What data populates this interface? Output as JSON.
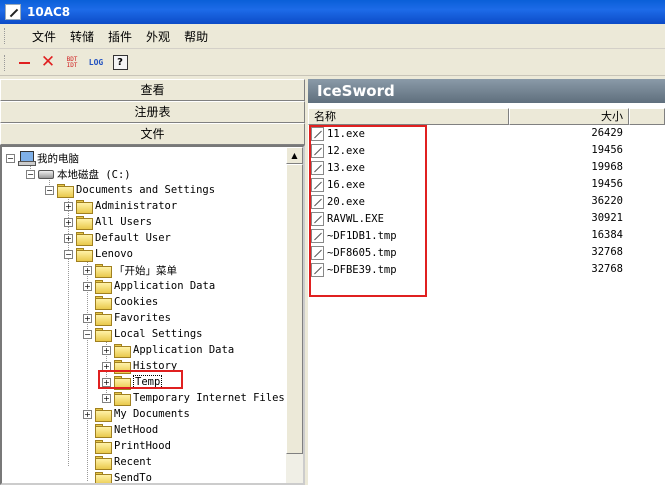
{
  "window": {
    "title": "10AC8"
  },
  "menu": {
    "items": [
      "文件",
      "转储",
      "插件",
      "外观",
      "帮助"
    ]
  },
  "toolbar": {
    "bdt_top": "BDT",
    "bdt_bottom": "IDT",
    "log": "LOG",
    "help": "?"
  },
  "nav": {
    "buttons": [
      "查看",
      "注册表",
      "文件"
    ]
  },
  "tree": {
    "nodes": [
      "我的电脑",
      "本地磁盘 (C:)",
      "Documents and Settings",
      "Administrator",
      "All Users",
      "Default User",
      "Lenovo",
      "「开始」菜单",
      "Application Data",
      "Cookies",
      "Favorites",
      "Local Settings",
      "Application Data",
      "History",
      "Temp",
      "Temporary Internet Files",
      "My Documents",
      "NetHood",
      "PrintHood",
      "Recent",
      "SendTo"
    ]
  },
  "files": {
    "header": "IceSword",
    "col_name": "名称",
    "col_size": "大小",
    "rows": [
      {
        "name": "11.exe",
        "size": "26429"
      },
      {
        "name": "12.exe",
        "size": "19456"
      },
      {
        "name": "13.exe",
        "size": "19968"
      },
      {
        "name": "16.exe",
        "size": "19456"
      },
      {
        "name": "20.exe",
        "size": "36220"
      },
      {
        "name": "RAVWL.EXE",
        "size": "30921"
      },
      {
        "name": "~DF1DB1.tmp",
        "size": "16384"
      },
      {
        "name": "~DF8605.tmp",
        "size": "32768"
      },
      {
        "name": "~DFBE39.tmp",
        "size": "32768"
      }
    ]
  },
  "colors": {
    "highlight_box": "#e02020",
    "title_bar": "#0a5fd8"
  }
}
